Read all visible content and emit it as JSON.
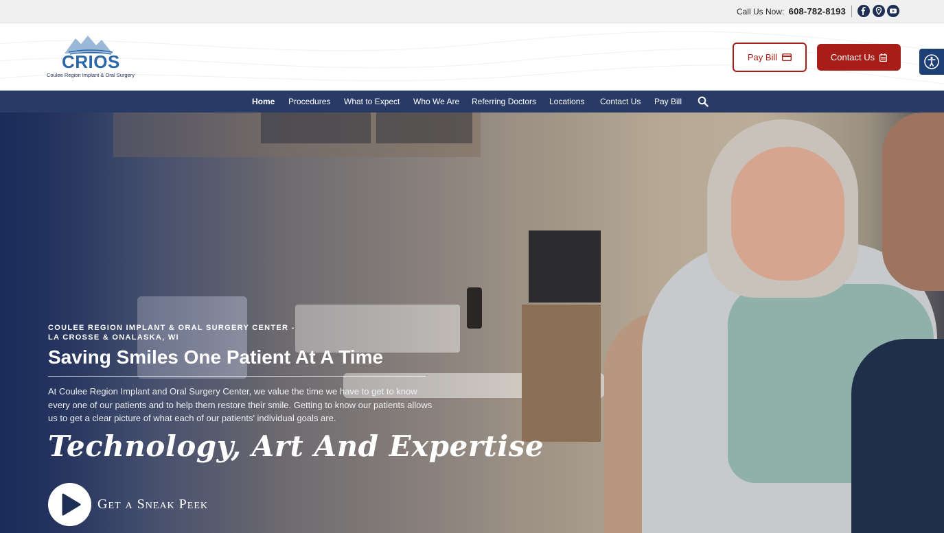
{
  "topbar": {
    "call_label": "Call Us Now:",
    "phone": "608-782-8193",
    "social_icons": [
      "facebook-icon",
      "map-pin-icon",
      "youtube-icon"
    ]
  },
  "header": {
    "logo_word": "CRIOS",
    "logo_subtitle": "Coulee Region Implant & Oral Surgery",
    "pay_bill_label": "Pay Bill",
    "contact_label": "Contact Us"
  },
  "nav": {
    "items": [
      {
        "label": "Home",
        "active": true
      },
      {
        "label": "Procedures"
      },
      {
        "label": "What to Expect"
      },
      {
        "label": "Who We Are"
      },
      {
        "label": "Referring Doctors"
      },
      {
        "label": "Locations"
      },
      {
        "label": "Contact Us"
      },
      {
        "label": "Pay Bill"
      }
    ]
  },
  "hero": {
    "eyebrow_line1": "COULEE REGION IMPLANT & ORAL SURGERY CENTER -",
    "eyebrow_line2": "LA CROSSE & ONALASKA, WI",
    "headline": "Saving Smiles One Patient At A Time",
    "paragraph": "At Coulee Region Implant and Oral Surgery Center, we value the time we have to get to know every one of our patients and to help them restore their smile. Getting to know our patients allows us to get a clear picture of what each of our patients' individual goals are.",
    "script_heading": "Technology, Art And Expertise",
    "video_label": "Get a Sneak Peek"
  },
  "colors": {
    "brand_navy": "#283a66",
    "brand_red": "#a81d17",
    "logo_blue": "#2b66a8"
  }
}
